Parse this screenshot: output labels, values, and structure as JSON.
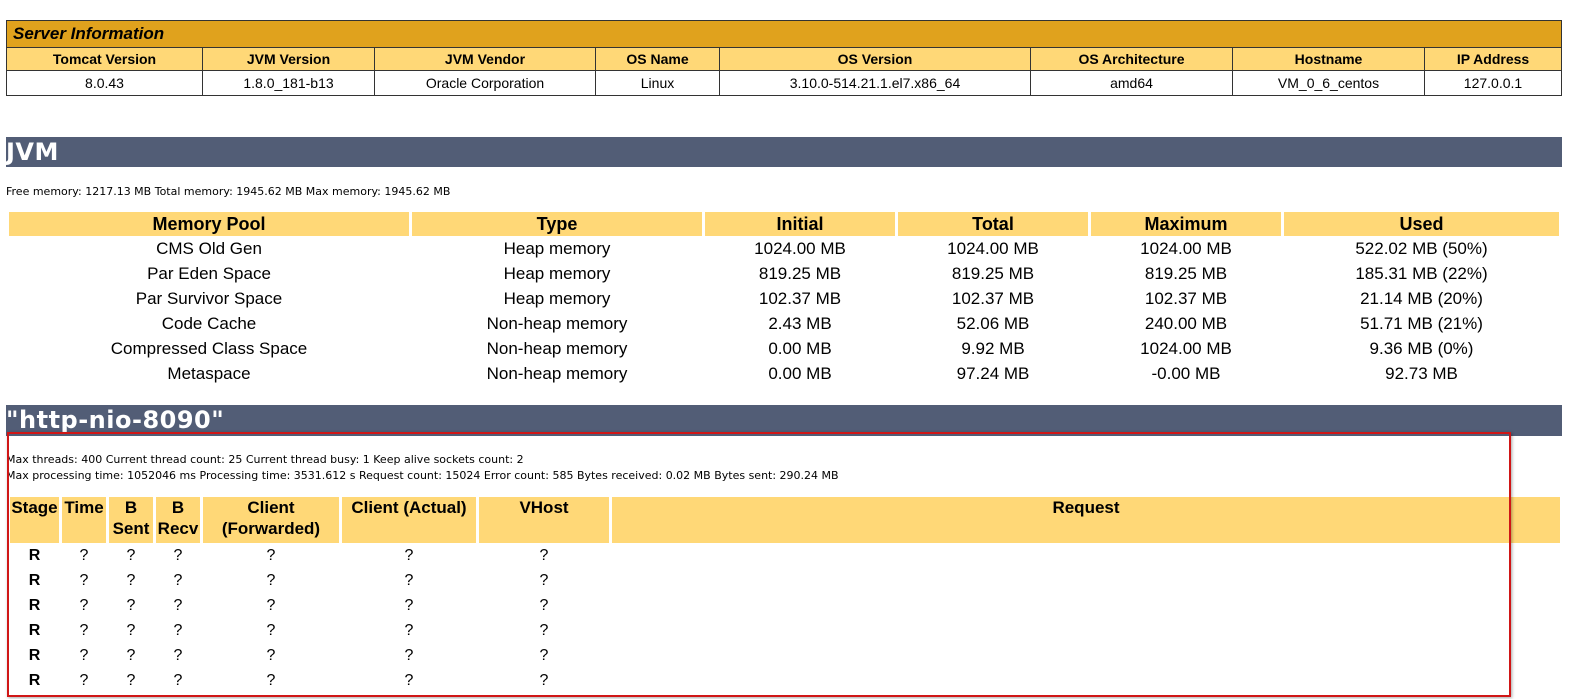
{
  "server_info": {
    "title": "Server Information",
    "headers": [
      "Tomcat Version",
      "JVM Version",
      "JVM Vendor",
      "OS Name",
      "OS Version",
      "OS Architecture",
      "Hostname",
      "IP Address"
    ],
    "values": [
      "8.0.43",
      "1.8.0_181-b13",
      "Oracle Corporation",
      "Linux",
      "3.10.0-514.21.1.el7.x86_64",
      "amd64",
      "VM_0_6_centos",
      "127.0.0.1"
    ]
  },
  "jvm": {
    "title": "JVM",
    "memory_summary": "Free memory: 1217.13 MB Total memory: 1945.62 MB Max memory: 1945.62 MB",
    "headers": [
      "Memory Pool",
      "Type",
      "Initial",
      "Total",
      "Maximum",
      "Used"
    ],
    "rows": [
      [
        "CMS Old Gen",
        "Heap memory",
        "1024.00 MB",
        "1024.00 MB",
        "1024.00 MB",
        "522.02 MB (50%)"
      ],
      [
        "Par Eden Space",
        "Heap memory",
        "819.25 MB",
        "819.25 MB",
        "819.25 MB",
        "185.31 MB (22%)"
      ],
      [
        "Par Survivor Space",
        "Heap memory",
        "102.37 MB",
        "102.37 MB",
        "102.37 MB",
        "21.14 MB (20%)"
      ],
      [
        "Code Cache",
        "Non-heap memory",
        "2.43 MB",
        "52.06 MB",
        "240.00 MB",
        "51.71 MB (21%)"
      ],
      [
        "Compressed Class Space",
        "Non-heap memory",
        "0.00 MB",
        "9.92 MB",
        "1024.00 MB",
        "9.36 MB (0%)"
      ],
      [
        "Metaspace",
        "Non-heap memory",
        "0.00 MB",
        "97.24 MB",
        "-0.00 MB",
        "92.73 MB"
      ]
    ]
  },
  "connector": {
    "title": "\"http-nio-8090\"",
    "thread_info_1": "Max threads: 400 Current thread count: 25 Current thread busy: 1 Keep alive sockets count: 2",
    "thread_info_2": "Max processing time: 1052046 ms Processing time: 3531.612 s Request count: 15024 Error count: 585 Bytes received: 0.02 MB Bytes sent: 290.24 MB",
    "headers": [
      {
        "line1": "Stage",
        "line2": ""
      },
      {
        "line1": "Time",
        "line2": ""
      },
      {
        "line1": "B",
        "line2": "Sent"
      },
      {
        "line1": "B",
        "line2": "Recv"
      },
      {
        "line1": "Client",
        "line2": "(Forwarded)"
      },
      {
        "line1": "Client (Actual)",
        "line2": ""
      },
      {
        "line1": "VHost",
        "line2": ""
      },
      {
        "line1": "Request",
        "line2": ""
      }
    ],
    "rows": [
      [
        "R",
        "?",
        "?",
        "?",
        "?",
        "?",
        "?",
        ""
      ],
      [
        "R",
        "?",
        "?",
        "?",
        "?",
        "?",
        "?",
        ""
      ],
      [
        "R",
        "?",
        "?",
        "?",
        "?",
        "?",
        "?",
        ""
      ],
      [
        "R",
        "?",
        "?",
        "?",
        "?",
        "?",
        "?",
        ""
      ],
      [
        "R",
        "?",
        "?",
        "?",
        "?",
        "?",
        "?",
        ""
      ],
      [
        "R",
        "?",
        "?",
        "?",
        "?",
        "?",
        "?",
        ""
      ]
    ]
  },
  "colors": {
    "title_bar": "#e0a21d",
    "header_bg": "#ffd877",
    "section_bar": "#525d76",
    "highlight": "#d01616"
  }
}
